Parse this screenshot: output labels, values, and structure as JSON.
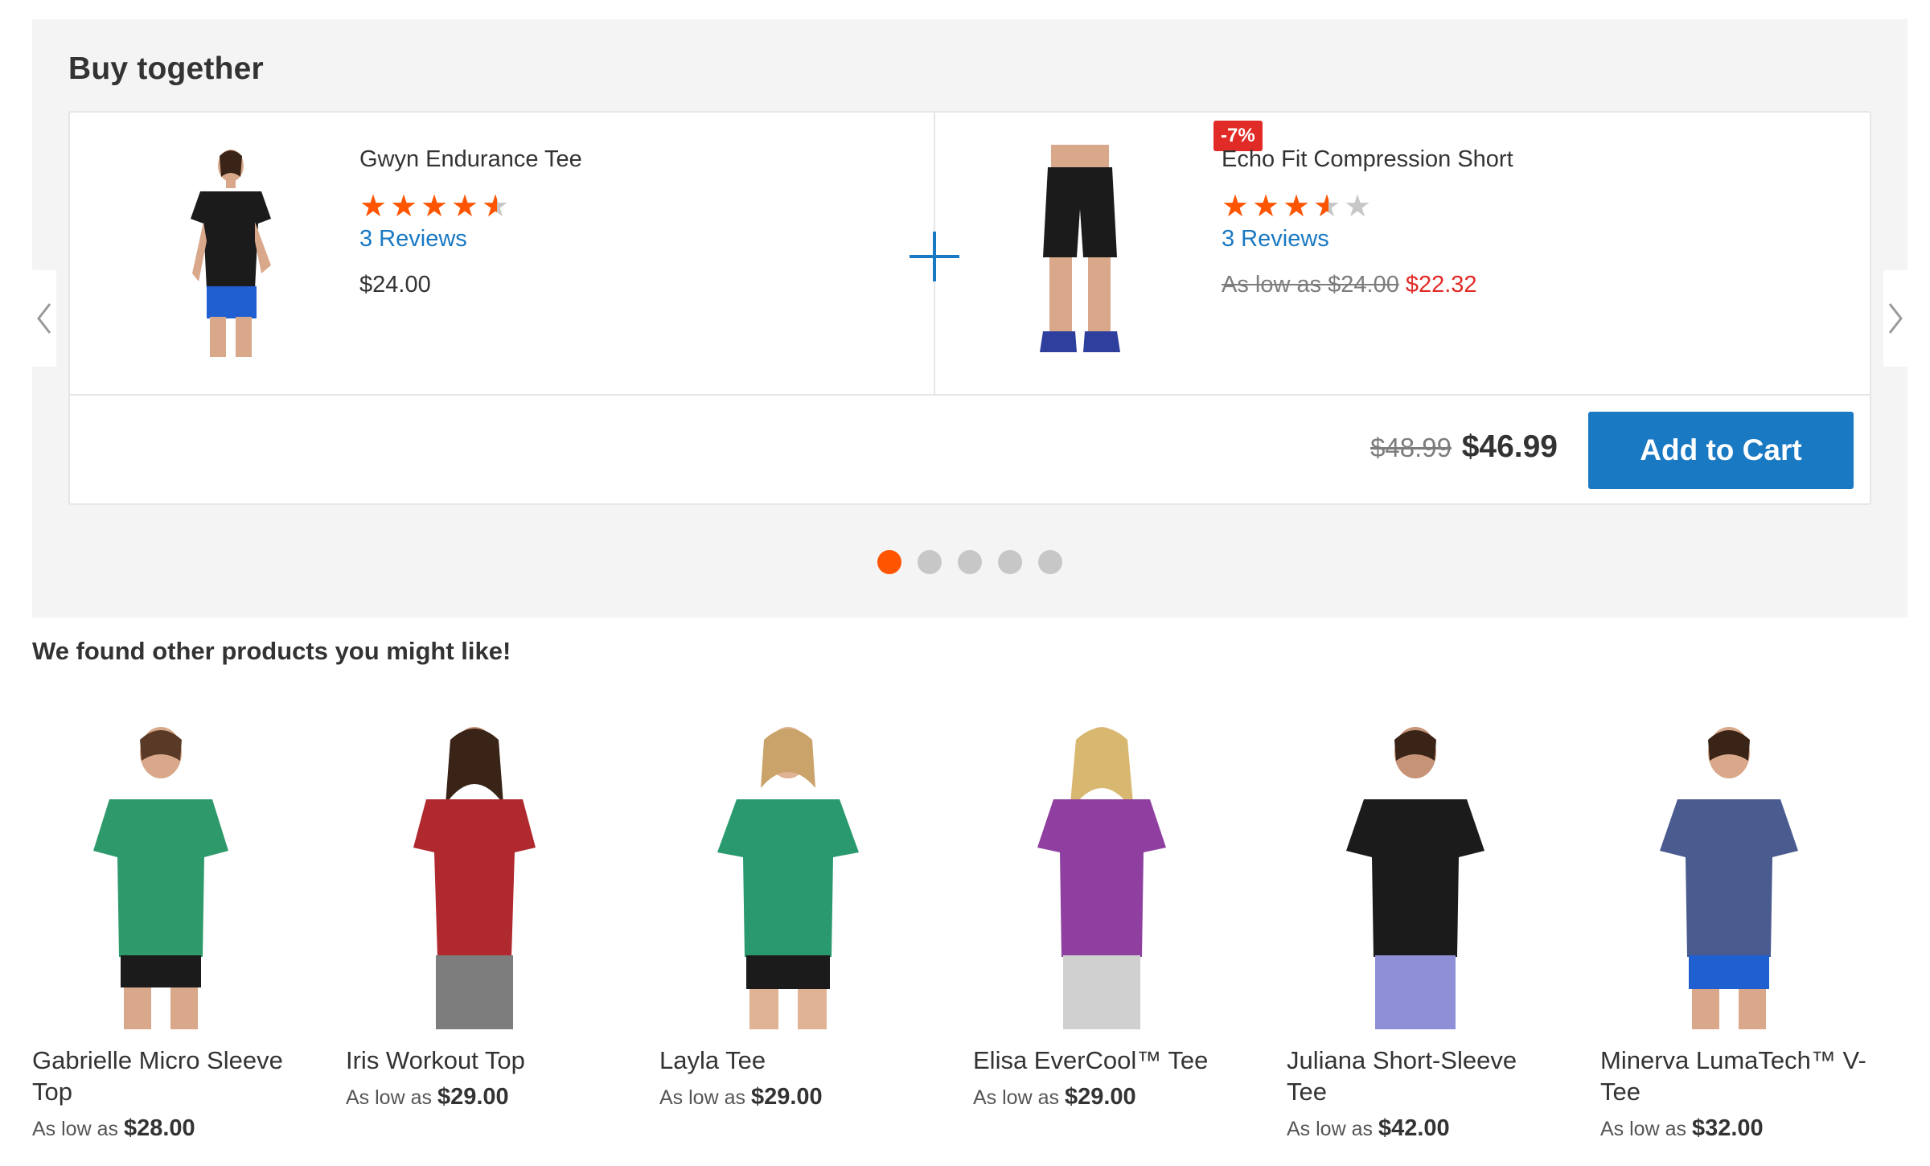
{
  "buy_together": {
    "title": "Buy together",
    "products": [
      {
        "name": "Gwyn Endurance Tee",
        "rating_stars": 4.5,
        "reviews": "3 Reviews",
        "price": "$24.00"
      },
      {
        "name": "Echo Fit Compression Short",
        "badge": "-7%",
        "rating_stars": 3.5,
        "reviews": "3 Reviews",
        "old_price": "As low as $24.00",
        "new_price": "$22.32"
      }
    ],
    "total_old": "$48.99",
    "total_new": "$46.99",
    "add_to_cart": "Add to Cart",
    "pager": {
      "count": 5,
      "active": 1
    }
  },
  "related": {
    "title": "We found other products you might like!",
    "prefix": "As low as",
    "items": [
      {
        "name": "Gabrielle Micro Sleeve Top",
        "price": "$28.00"
      },
      {
        "name": "Iris Workout Top",
        "price": "$29.00"
      },
      {
        "name": "Layla Tee",
        "price": "$29.00"
      },
      {
        "name": "Elisa EverCool™ Tee",
        "price": "$29.00"
      },
      {
        "name": "Juliana Short-Sleeve Tee",
        "price": "$42.00"
      },
      {
        "name": "Minerva LumaTech™ V-Tee",
        "price": "$32.00"
      }
    ]
  },
  "colors": {
    "accent_blue": "#1979c3",
    "star_orange": "#ff5501",
    "sale_red": "#e02b27",
    "shirt_colors": [
      "#2e9a6b",
      "#b0292f",
      "#2a9a6e",
      "#8f3fa0",
      "#1b1b1b",
      "#4a5b8f"
    ]
  }
}
